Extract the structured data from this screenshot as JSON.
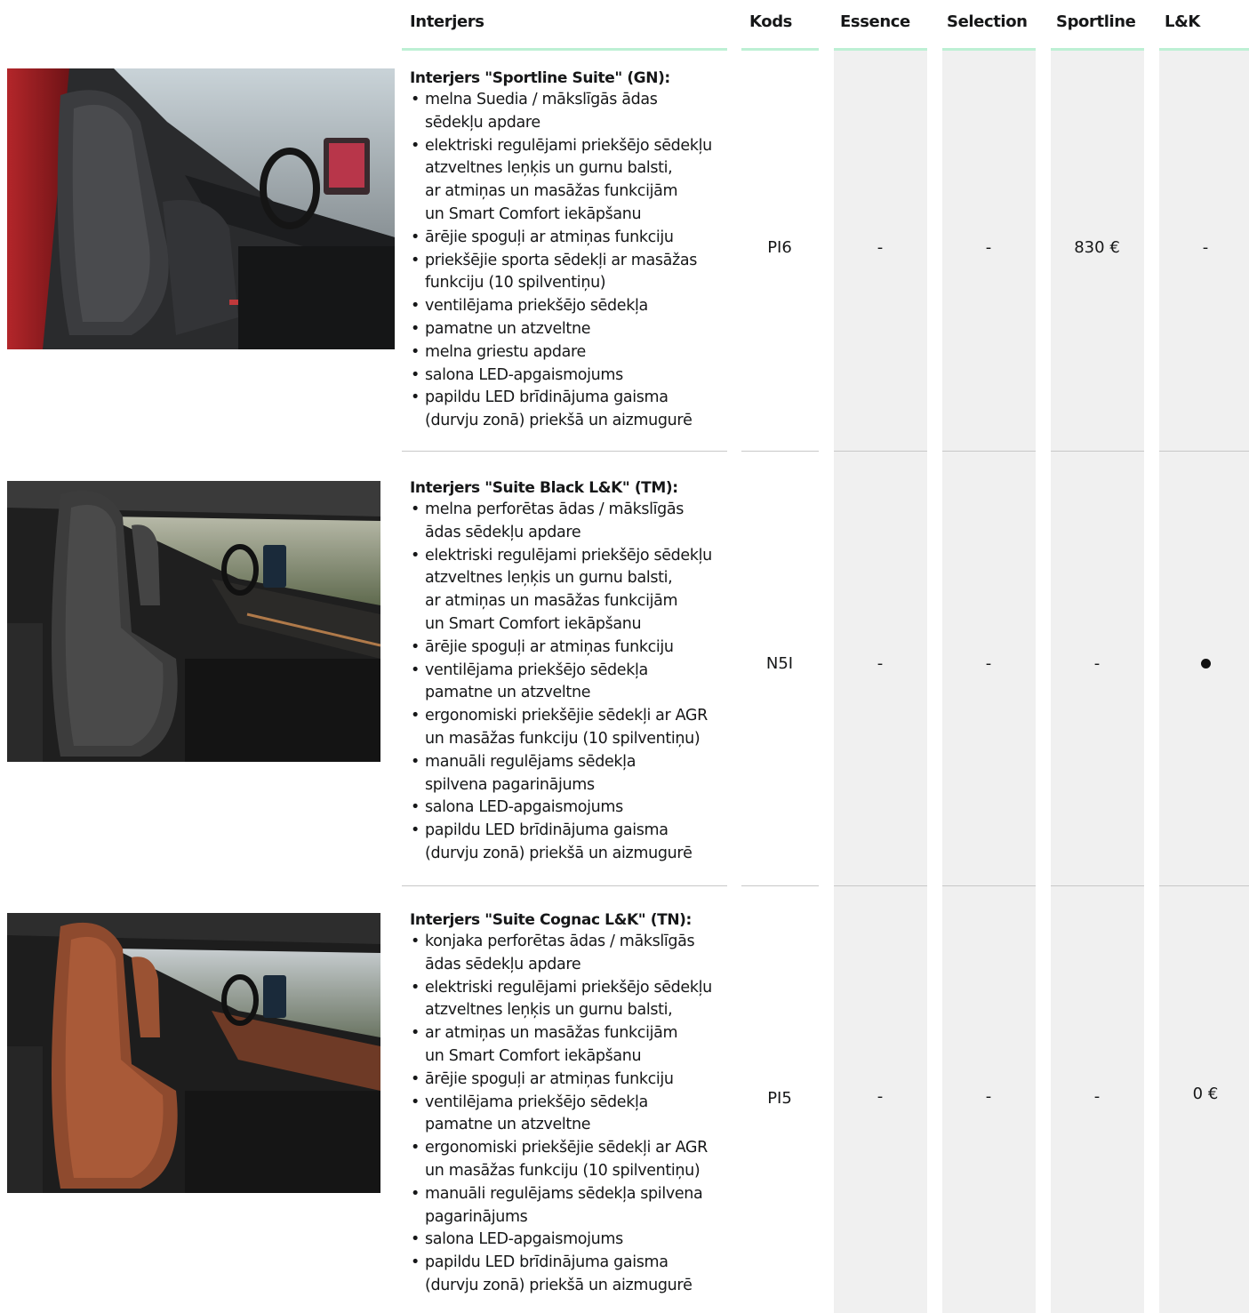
{
  "columns": {
    "interior": "Interjers",
    "code": "Kods",
    "essence": "Essence",
    "selection": "Selection",
    "sportline": "Sportline",
    "lk": "L&K"
  },
  "colors": {
    "header_underline": "#bdf0d4",
    "column_shade": "#f0f0f0",
    "separator": "#c8c8c8"
  },
  "rows": [
    {
      "title": "Interjers \"Sportline Suite\" (GN):",
      "features": [
        "melna Suedia / mākslīgās ādas\nsēdekļu apdare",
        "elektriski regulējami priekšējo sēdekļu\natzveltnes leņķis un gurnu balsti,\nar atmiņas un masāžas funkcijām\nun Smart Comfort iekāpšanu",
        "ārējie spoguļi ar atmiņas funkciju",
        "priekšējie sporta sēdekļi ar masāžas\nfunkciju (10 spilventiņu)",
        "ventilējama priekšējo sēdekļa",
        "pamatne un atzveltne",
        "melna griestu apdare",
        "salona LED-apgaismojums",
        "papildu LED brīdinājuma gaisma\n(durvju zonā) priekšā un aizmugurē"
      ],
      "code": "PI6",
      "essence": "-",
      "selection": "-",
      "sportline": "830 €",
      "lk": "-",
      "image": "interior-photo-sportline-black"
    },
    {
      "title": "Interjers \"Suite Black L&K\" (TM):",
      "features": [
        "melna perforētas ādas / mākslīgās\nādas sēdekļu apdare",
        "elektriski regulējami priekšējo sēdekļu\natzveltnes leņķis un gurnu balsti,\nar atmiņas un masāžas funkcijām\nun Smart Comfort iekāpšanu",
        "ārējie spoguļi ar atmiņas funkciju",
        "ventilējama priekšējo sēdekļa\npamatne un atzveltne",
        "ergonomiski priekšējie sēdekļi ar AGR\nun  masāžas funkciju (10 spilventiņu)",
        "manuāli regulējams sēdekļa\nspilvena pagarinājums",
        "salona LED-apgaismojums",
        "papildu LED brīdinājuma gaisma\n(durvju zonā) priekšā un aizmugurē"
      ],
      "code": "N5I",
      "essence": "-",
      "selection": "-",
      "sportline": "-",
      "lk_icon": "standard-dot",
      "image": "interior-photo-black-lk"
    },
    {
      "title": "Interjers \"Suite Cognac L&K\" (TN):",
      "features": [
        "konjaka perforētas ādas / mākslīgās\nādas sēdekļu apdare",
        "elektriski regulējami priekšējo sēdekļu\natzveltnes leņķis un gurnu balsti,",
        "ar atmiņas un masāžas funkcijām\n un Smart Comfort iekāpšanu",
        "ārējie spoguļi ar atmiņas funkciju",
        "ventilējama priekšējo sēdekļa\npamatne un atzveltne",
        "ergonomiski priekšējie sēdekļi ar AGR\nun  masāžas funkciju (10 spilventiņu)",
        "manuāli regulējams sēdekļa spilvena\npagarinājums",
        "salona LED-apgaismojums",
        "papildu LED brīdinājuma gaisma\n(durvju zonā) priekšā un aizmugurē"
      ],
      "code": "PI5",
      "essence": "-",
      "selection": "-",
      "sportline": "-",
      "lk": "0 €",
      "image": "interior-photo-cognac-lk"
    }
  ]
}
